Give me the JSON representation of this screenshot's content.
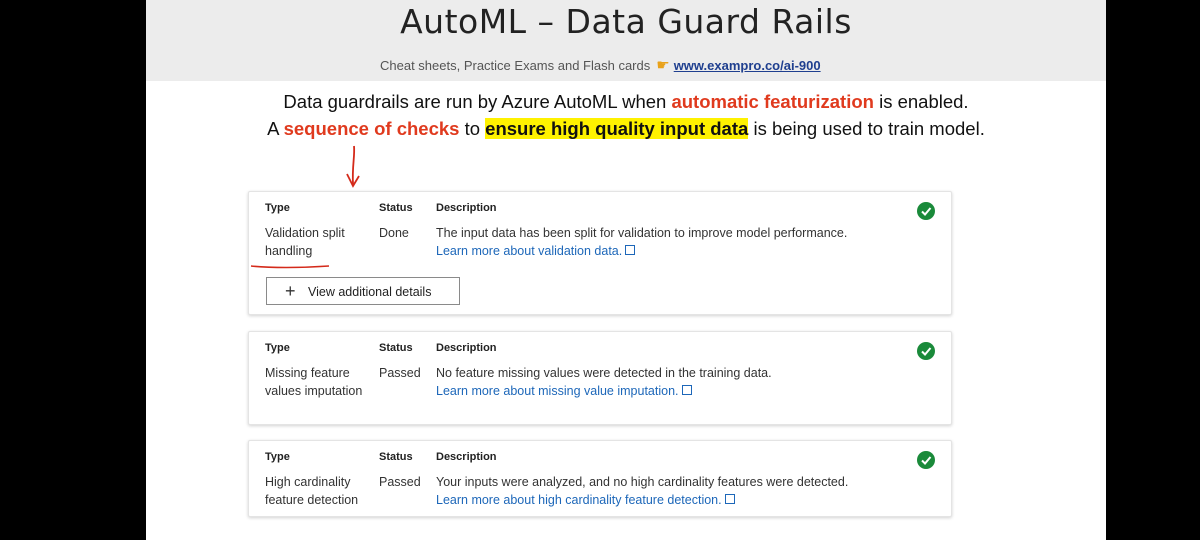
{
  "header": {
    "title": "AutoML – Data Guard Rails",
    "subline": "Cheat sheets, Practice Exams and Flash cards",
    "hand_icon": "pointing-hand-icon",
    "link": "www.exampro.co/ai-900"
  },
  "intro": {
    "line1_a": "Data guardrails are run by Azure AutoML when ",
    "line1_red": "automatic featurization",
    "line1_b": " is enabled.",
    "line2_a": "A ",
    "line2_red": "sequence of checks",
    "line2_b": " to ",
    "line2_highlight": "ensure high quality input data",
    "line2_c": " is being used to train model."
  },
  "labels": {
    "type": "Type",
    "status": "Status",
    "description": "Description"
  },
  "cards": [
    {
      "type": "Validation split handling",
      "status": "Done",
      "description": "The input data has been split for validation to improve model performance.",
      "link": "Learn more about validation data.",
      "button": "View additional details"
    },
    {
      "type": "Missing feature values imputation",
      "status": "Passed",
      "description": "No feature missing values were detected in the training data.",
      "link": "Learn more about missing value imputation."
    },
    {
      "type": "High cardinality feature detection",
      "status": "Passed",
      "description": "Your inputs were analyzed, and no high cardinality features were detected.",
      "link": "Learn more about high cardinality feature detection."
    }
  ],
  "colors": {
    "accent_red": "#e03a1e",
    "highlight": "#fff200",
    "check_green": "#1a8a3a",
    "link_blue": "#1d67b9"
  }
}
